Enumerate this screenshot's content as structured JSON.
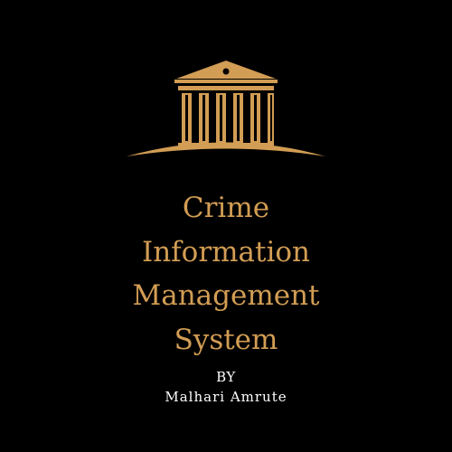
{
  "logo": {
    "icon": "courthouse-icon",
    "color": "#d29d54"
  },
  "title": {
    "lines": [
      "Crime",
      "Information",
      "Management",
      "System"
    ],
    "color": "#d29d54"
  },
  "byline": {
    "by_label": "BY",
    "author": "Malhari Amrute",
    "color": "#ffffff"
  },
  "background_color": "#000000"
}
